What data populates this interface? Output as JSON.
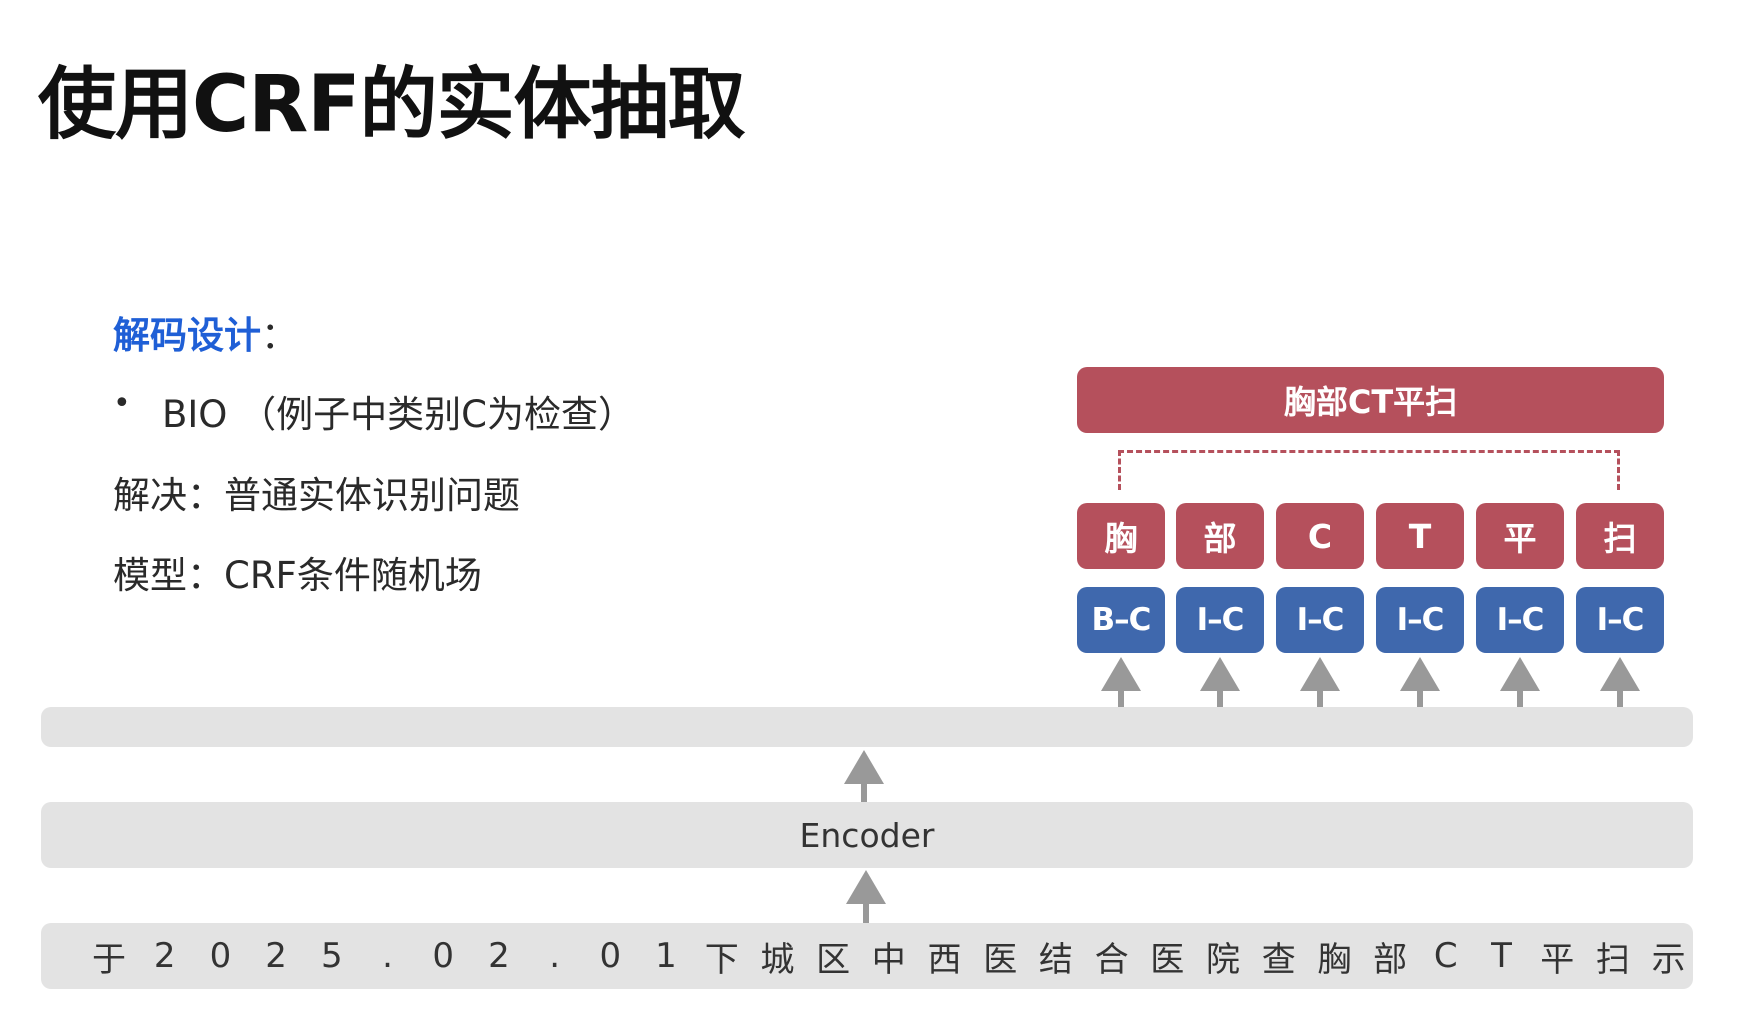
{
  "title": "使用CRF的实体抽取",
  "decoding": {
    "label": "解码设计",
    "colon": "：",
    "bullet": "BIO （例子中类别C为检查）",
    "solve": "解决：普通实体识别问题",
    "model": "模型：CRF条件随机场"
  },
  "diagram": {
    "entity": "胸部CT平扫",
    "chars": [
      "胸",
      "部",
      "C",
      "T",
      "平",
      "扫"
    ],
    "tags": [
      "B–C",
      "I–C",
      "I–C",
      "I–C",
      "I–C",
      "I–C"
    ],
    "encoder_label": "Encoder",
    "input_chars": [
      "于",
      "2",
      "0",
      "2",
      "5",
      ".",
      "0",
      "2",
      ".",
      "0",
      "1",
      "下",
      "城",
      "区",
      "中",
      "西",
      "医",
      "结",
      "合",
      "医",
      "院",
      "查",
      "胸",
      "部",
      "C",
      "T",
      "平",
      "扫",
      "示"
    ]
  },
  "colors": {
    "entity_red": "#b5505c",
    "tag_blue": "#3f68ad",
    "bar_gray": "#e3e3e3",
    "arrow_gray": "#999999",
    "accent_blue": "#1f5fd6"
  }
}
